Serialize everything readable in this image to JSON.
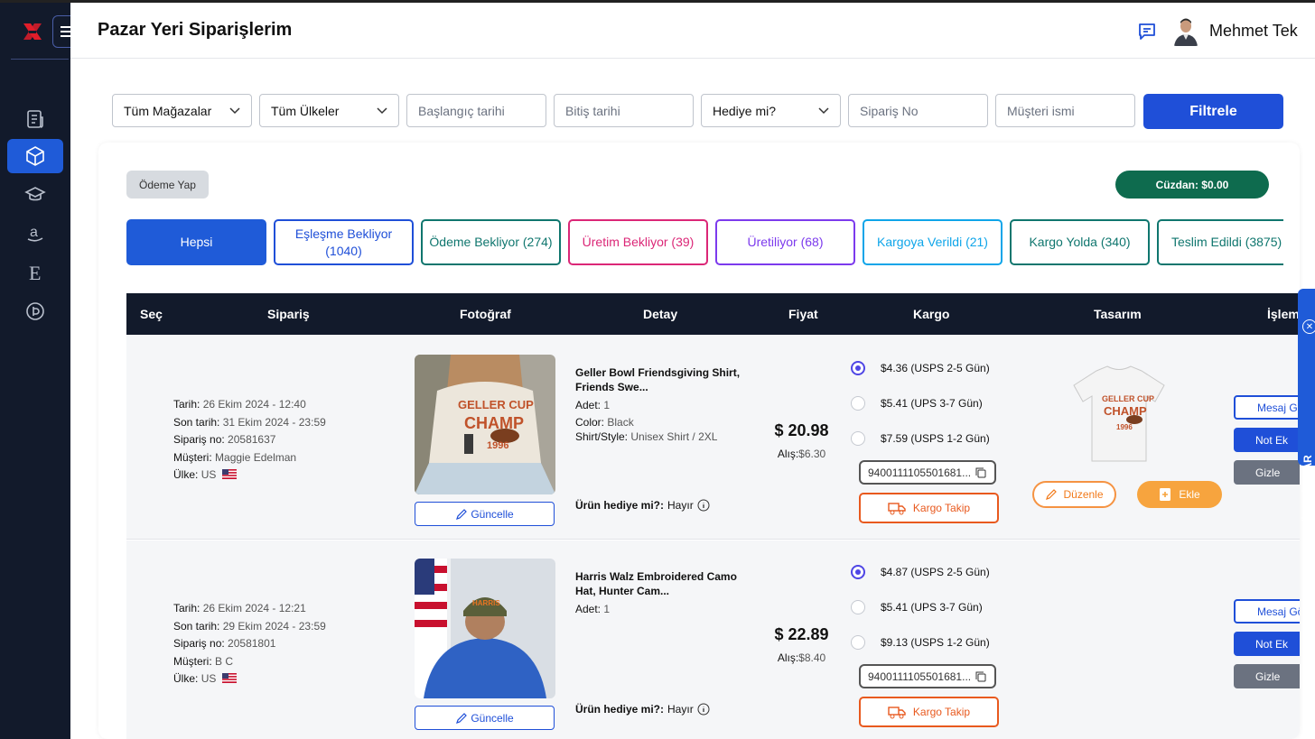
{
  "header": {
    "title": "Pazar Yeri Siparişlerim",
    "user_name": "Mehmet Tek"
  },
  "filters": {
    "store": "Tüm Mağazalar",
    "country": "Tüm Ülkeler",
    "start_date_placeholder": "Başlangıç tarihi",
    "end_date_placeholder": "Bitiş tarihi",
    "gift": "Hediye mi?",
    "order_no_placeholder": "Sipariş No",
    "customer_placeholder": "Müşteri ismi",
    "filter_button": "Filtrele"
  },
  "toolbar": {
    "pay_button": "Ödeme Yap",
    "wallet": "Cüzdan: $0.00"
  },
  "tabs": [
    {
      "label": "Hepsi",
      "color": "#1f5bd8"
    },
    {
      "label": "Eşleşme Bekliyor (1040)",
      "color": "#1f4fd8"
    },
    {
      "label": "Ödeme Bekliyor (274)",
      "color": "#0f766e"
    },
    {
      "label": "Üretim Bekliyor (39)",
      "color": "#db2777"
    },
    {
      "label": "Üretiliyor (68)",
      "color": "#7c3aed"
    },
    {
      "label": "Kargoya Verildi (21)",
      "color": "#0ea5e9"
    },
    {
      "label": "Kargo Yolda (340)",
      "color": "#0f766e"
    },
    {
      "label": "Teslim Edildi (3875)",
      "color": "#0f766e"
    }
  ],
  "columns": [
    "Seç",
    "Sipariş",
    "Fotoğraf",
    "Detay",
    "Fiyat",
    "Kargo",
    "Tasarım",
    "İşlem"
  ],
  "labels": {
    "date": "Tarih:",
    "deadline": "Son tarih:",
    "order_no": "Sipariş no:",
    "customer": "Müşteri:",
    "country": "Ülke:",
    "quantity": "Adet:",
    "color": "Color:",
    "style": "Shirt/Style:",
    "gift_question": "Ürün hediye mi?:",
    "purchase": "Alış:",
    "update": "Güncelle",
    "track": "Kargo Takip",
    "edit": "Düzenle",
    "add": "Ekle",
    "message": "Mesaj Gö",
    "note": "Not Ek",
    "hide": "Gizle"
  },
  "orders": [
    {
      "date": "26 Ekim 2024 - 12:40",
      "deadline": "31 Ekim 2024 - 23:59",
      "order_no": "20581637",
      "customer": "Maggie Edelman",
      "country": "US",
      "title": "Geller Bowl Friendsgiving Shirt, Friends Swe...",
      "quantity": "1",
      "color": "Black",
      "style": "Unisex Shirt / 2XL",
      "gift": "Hayır",
      "price": "$ 20.98",
      "purchase": "$6.30",
      "shipping": [
        "$4.36 (USPS 2-5 Gün)",
        "$5.41 (UPS 3-7 Gün)",
        "$7.59 (USPS 1-2 Gün)"
      ],
      "tracking": "9400111105501681..."
    },
    {
      "date": "26 Ekim 2024 - 12:21",
      "deadline": "29 Ekim 2024 - 23:59",
      "order_no": "20581801",
      "customer": "B C",
      "country": "US",
      "title": "Harris Walz Embroidered Camo Hat, Hunter Cam...",
      "quantity": "1",
      "gift": "Hayır",
      "price": "$ 22.89",
      "purchase": "$8.40",
      "shipping": [
        "$4.87 (USPS 2-5 Gün)",
        "$5.41 (UPS 3-7 Gün)",
        "$9.13 (USPS 1-2 Gün)"
      ],
      "tracking": "9400111105501681..."
    }
  ],
  "suggestion_tab": "ÖNERİM VAR",
  "icons": [
    "logo-icon",
    "menu-icon",
    "orders-icon",
    "box-icon",
    "education-icon",
    "amazon-icon",
    "etsy-icon",
    "custom-icon",
    "chat-icon",
    "chevron-down-icon",
    "info-icon",
    "copy-icon",
    "truck-icon",
    "pencil-icon",
    "file-plus-icon",
    "close-icon"
  ]
}
